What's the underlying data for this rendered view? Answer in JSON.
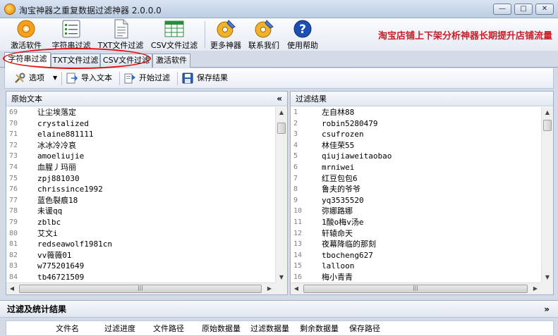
{
  "window": {
    "title": "淘宝神器之重复数据过滤神器 2.0.0.0",
    "minimize": "—",
    "maximize": "□",
    "close": "✕"
  },
  "toolbar": {
    "buttons": [
      {
        "label": "激活软件",
        "icon": "activate-disc-icon"
      },
      {
        "label": "字符串过滤",
        "icon": "list-document-icon"
      },
      {
        "label": "TXT文件过滤",
        "icon": "text-file-icon"
      },
      {
        "label": "CSV文件过滤",
        "icon": "spreadsheet-icon"
      },
      {
        "label": "更多神器",
        "icon": "cd-tools-icon"
      },
      {
        "label": "联系我们",
        "icon": "cd-contact-icon"
      },
      {
        "label": "使用帮助",
        "icon": "help-icon"
      }
    ],
    "slogan": "淘宝店铺上下架分析神器长期提升店铺流量"
  },
  "tabs": [
    {
      "label": "字符串过滤",
      "active": true
    },
    {
      "label": "TXT文件过滤",
      "active": false
    },
    {
      "label": "CSV文件过滤",
      "active": false
    },
    {
      "label": "激活软件",
      "active": false
    }
  ],
  "actions": {
    "options": "选项",
    "import": "导入文本",
    "start": "开始过滤",
    "save": "保存结果"
  },
  "left_panel": {
    "title": "原始文本",
    "collapse": "«",
    "rows": [
      {
        "n": "69",
        "t": "让尘埃落定"
      },
      {
        "n": "70",
        "t": "crystalized"
      },
      {
        "n": "71",
        "t": "elaine881111"
      },
      {
        "n": "72",
        "t": "冰冰冷冷哀"
      },
      {
        "n": "73",
        "t": "amoeliujie"
      },
      {
        "n": "74",
        "t": "血腥丿玛丽"
      },
      {
        "n": "75",
        "t": "zpj881030"
      },
      {
        "n": "76",
        "t": "chrissince1992"
      },
      {
        "n": "77",
        "t": "蓝色裂痕18"
      },
      {
        "n": "78",
        "t": "未谖qq"
      },
      {
        "n": "79",
        "t": "zblbc"
      },
      {
        "n": "80",
        "t": "艾文i"
      },
      {
        "n": "81",
        "t": "redseawolf1981cn"
      },
      {
        "n": "82",
        "t": "vv薇薇01"
      },
      {
        "n": "83",
        "t": "w775201649"
      },
      {
        "n": "84",
        "t": "tb46721509"
      }
    ]
  },
  "right_panel": {
    "title": "过滤结果",
    "rows": [
      {
        "n": "1",
        "t": "左自林88"
      },
      {
        "n": "2",
        "t": "robin5280479"
      },
      {
        "n": "3",
        "t": "csufrozen"
      },
      {
        "n": "4",
        "t": "林佳荣55"
      },
      {
        "n": "5",
        "t": "qiujiaweitaobao"
      },
      {
        "n": "6",
        "t": "mrniwei"
      },
      {
        "n": "7",
        "t": "红豆包包6"
      },
      {
        "n": "8",
        "t": "鲁夫的爷爷"
      },
      {
        "n": "9",
        "t": "yq3535520"
      },
      {
        "n": "10",
        "t": "弥娜路娜"
      },
      {
        "n": "11",
        "t": "1酸o梅v汤e"
      },
      {
        "n": "12",
        "t": "轩辕命天"
      },
      {
        "n": "13",
        "t": "夜幕降临的那刻"
      },
      {
        "n": "14",
        "t": "tbocheng627"
      },
      {
        "n": "15",
        "t": "lalloon"
      },
      {
        "n": "16",
        "t": "梅小青青"
      }
    ]
  },
  "stats": {
    "title": "过滤及统计结果",
    "expand": "»",
    "columns": [
      "文件名",
      "过滤进度",
      "文件路径",
      "原始数据量",
      "过滤数据量",
      "剩余数据量",
      "保存路径"
    ]
  },
  "colors": {
    "slogan": "#c8202a",
    "highlight_oval": "#e01010",
    "help_blue": "#1b4fb3",
    "spreadsheet_green": "#2e8b3a"
  }
}
